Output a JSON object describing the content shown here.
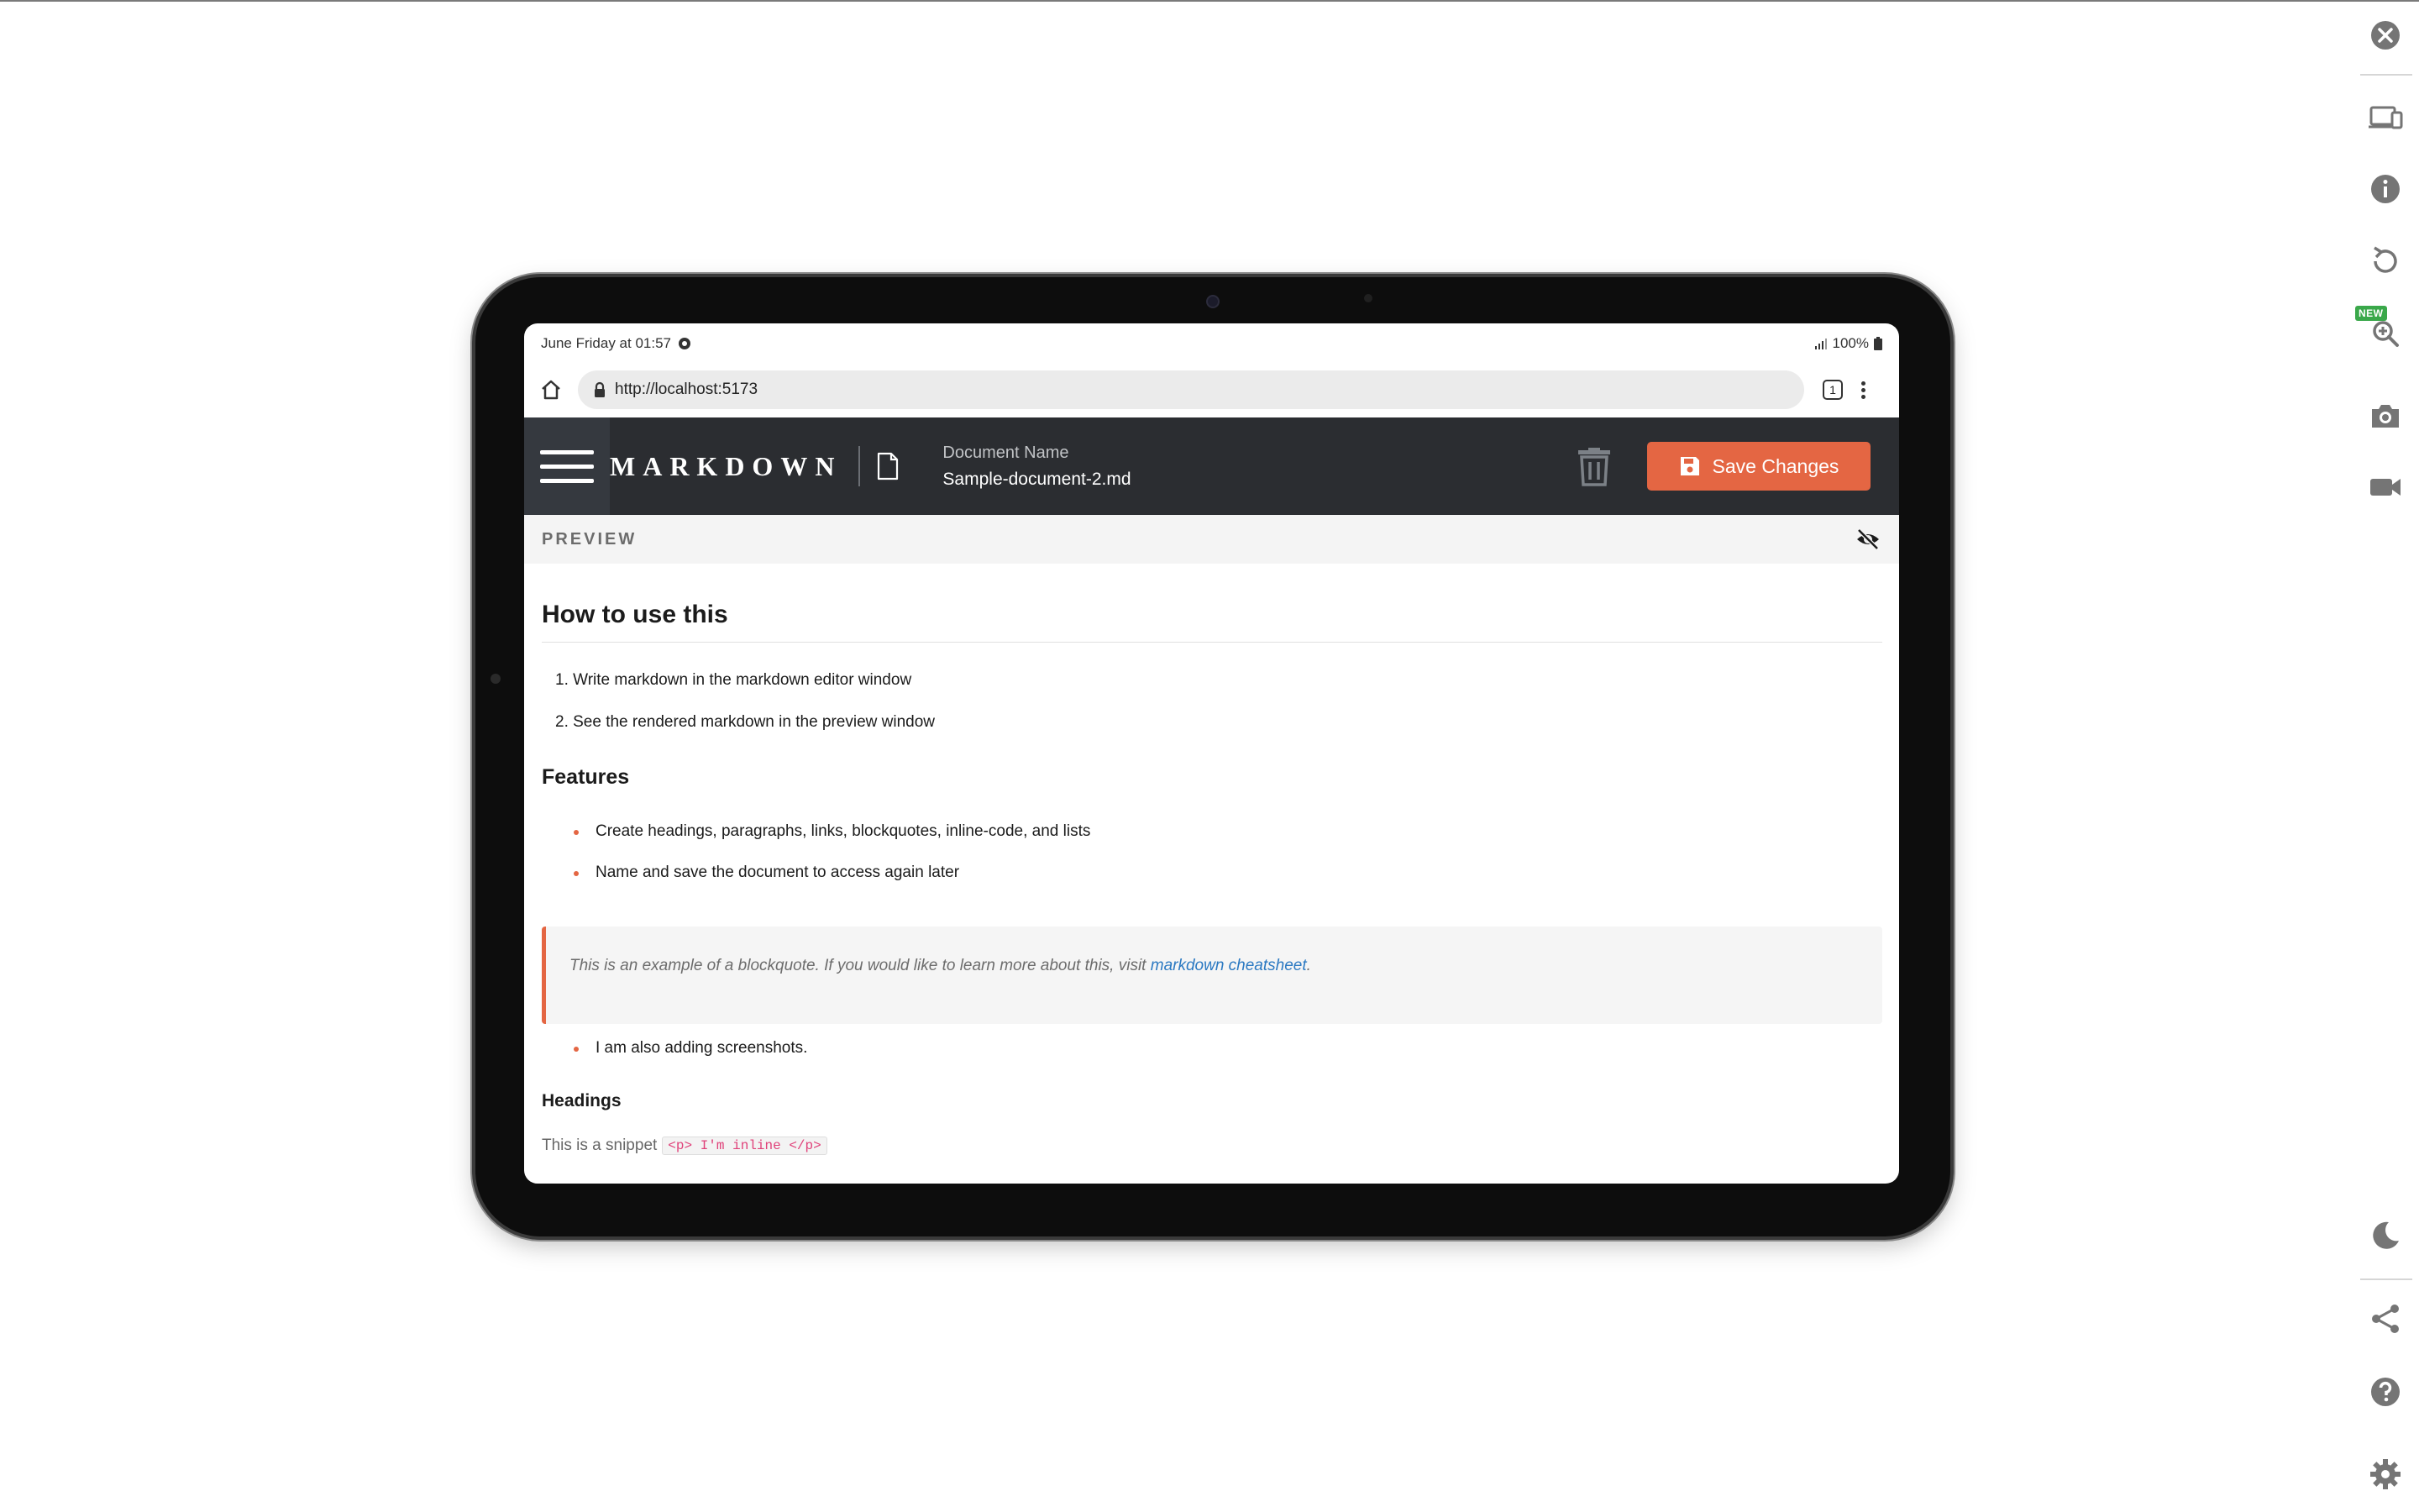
{
  "toolbar": {
    "items": [
      "close-icon",
      "devices-icon",
      "info-icon",
      "rotate-icon",
      "zoom-icon",
      "camera-icon",
      "video-icon",
      "moon-icon",
      "share-icon",
      "help-icon",
      "gear-icon"
    ],
    "new_badge": "NEW"
  },
  "status_bar": {
    "time": "June Friday at 01:57",
    "battery": "100%"
  },
  "browser": {
    "url": "http://localhost:5173",
    "tab_count": "1"
  },
  "app": {
    "brand": "MARKDOWN",
    "document_label": "Document Name",
    "document_name": "Sample-document-2.md",
    "save_label": "Save Changes",
    "preview_title": "PREVIEW"
  },
  "content": {
    "heading": "How to use this",
    "steps": [
      "1. Write markdown in the markdown editor window",
      "2. See the rendered markdown in the preview window"
    ],
    "features_heading": "Features",
    "features": [
      "Create headings, paragraphs, links, blockquotes, inline-code, and lists",
      "Name and save the document to access again later"
    ],
    "blockquote_text": "This is an example of a blockquote. If you would like to learn more about this, visit ",
    "blockquote_link": "markdown cheatsheet",
    "blockquote_end": ".",
    "extra_item": "I am also adding screenshots.",
    "headings_heading": "Headings",
    "snippet_text": "This is a snippet",
    "snippet_code": "<p> I'm inline </p>"
  },
  "colors": {
    "accent": "#e46643",
    "header_bg": "#2b2d31",
    "link": "#2b79c2"
  }
}
